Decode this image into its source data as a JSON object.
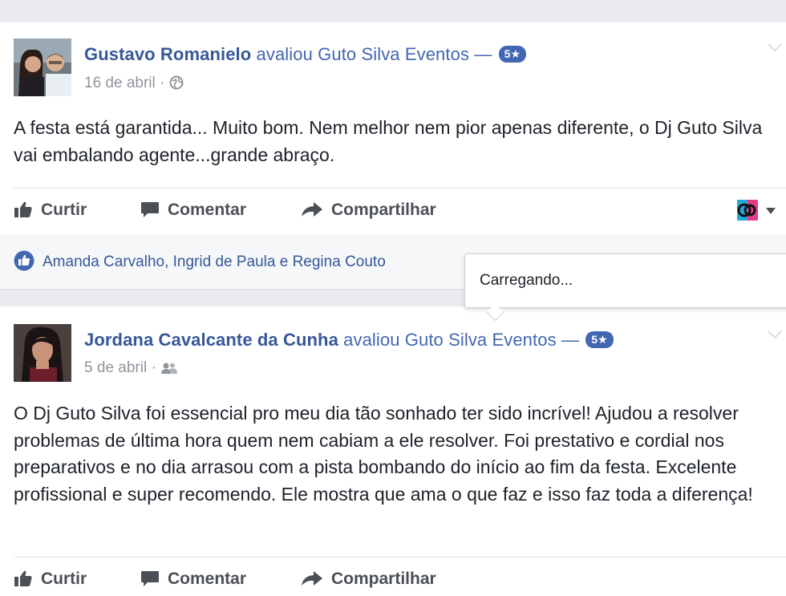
{
  "colors": {
    "link": "#365899",
    "accent": "#4267b2",
    "muted": "#90949c",
    "action": "#4b4f56",
    "background": "#e9ebee"
  },
  "posts": [
    {
      "author": "Gustavo Romanielo",
      "verb": "avaliou Guto Silva Eventos —",
      "rating": "5★",
      "date": "16 de abril",
      "date_separator": "·",
      "privacy_icon": "globe-icon",
      "text": "A festa está garantida... Muito bom. Nem melhor nem pior apenas diferente, o Dj Guto Silva vai embalando agente...grande abraço.",
      "actions": {
        "like": "Curtir",
        "comment": "Comentar",
        "share": "Compartilhar"
      },
      "likes_text": "Amanda Carvalho, Ingrid de Paula e Regina Couto"
    },
    {
      "author": "Jordana Cavalcante da Cunha",
      "verb": "avaliou Guto Silva Eventos —",
      "rating": "5★",
      "date": "5 de abril",
      "date_separator": "·",
      "privacy_icon": "friends-icon",
      "text": "O Dj Guto Silva foi essencial pro meu dia tão sonhado ter sido incrível! Ajudou a resolver problemas de última hora quem nem cabiam a ele resolver. Foi prestativo e cordial nos preparativos e no dia arrasou com a pista bombando do início ao fim da festa. Excelente profissional e super recomendo. Ele mostra que ama o que faz e isso faz toda a diferença!",
      "actions": {
        "like": "Curtir",
        "comment": "Comentar",
        "share": "Compartilhar"
      }
    }
  ],
  "tooltip": {
    "text": "Carregando..."
  }
}
